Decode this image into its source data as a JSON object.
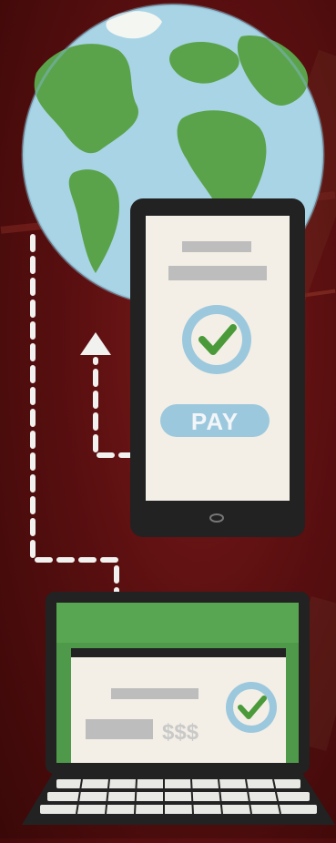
{
  "illustration": {
    "phone": {
      "pay_button_label": "PAY"
    },
    "laptop": {
      "price_label": "$$$"
    },
    "icons": [
      "globe-icon",
      "smartphone-icon",
      "checkmark-icon",
      "laptop-icon",
      "arrow-up-icon",
      "arrow-down-icon"
    ],
    "colors": {
      "background": "#5a0f10",
      "globe_ocean": "#a8d4e6",
      "globe_land": "#5aa34a",
      "device_frame": "#222222",
      "screen": "#f3efe6",
      "accent_blue": "#9cc8dd",
      "check_green": "#4a9a3a",
      "laptop_green": "#4f9a4a"
    }
  }
}
